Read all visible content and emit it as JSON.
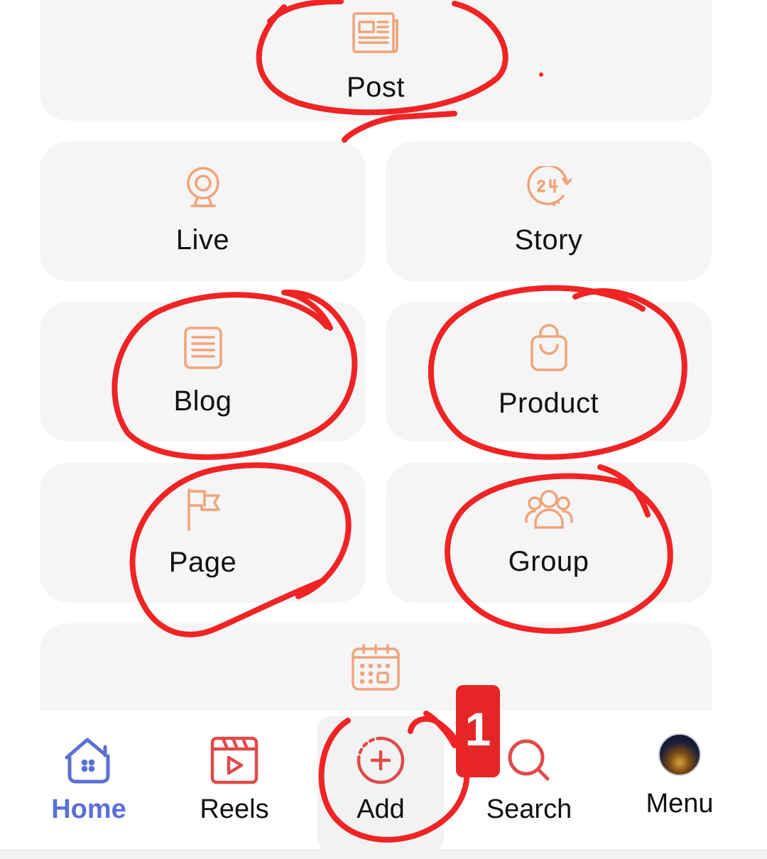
{
  "tiles": {
    "post": {
      "label": "Post",
      "icon": "newspaper-icon"
    },
    "live": {
      "label": "Live",
      "icon": "webcam-icon"
    },
    "story": {
      "label": "Story",
      "icon": "24-hour-icon"
    },
    "blog": {
      "label": "Blog",
      "icon": "document-icon"
    },
    "product": {
      "label": "Product",
      "icon": "shopping-bag-icon"
    },
    "page": {
      "label": "Page",
      "icon": "flag-icon"
    },
    "group": {
      "label": "Group",
      "icon": "people-group-icon"
    },
    "event": {
      "icon": "calendar-icon"
    }
  },
  "bottom_nav": {
    "items": [
      {
        "label": "Home",
        "icon": "home-icon",
        "active": true
      },
      {
        "label": "Reels",
        "icon": "clapperboard-play-icon"
      },
      {
        "label": "Add",
        "icon": "plus-circle-icon"
      },
      {
        "label": "Search",
        "icon": "search-icon"
      },
      {
        "label": "Menu",
        "icon": "avatar"
      }
    ],
    "badge": "1"
  },
  "colors": {
    "accent_icon": "#f0a47a",
    "home_active": "#5b6fd6",
    "nav_red": "#e04a4a",
    "annotation_red": "#f02424",
    "tile_bg": "#f5f5f5"
  }
}
